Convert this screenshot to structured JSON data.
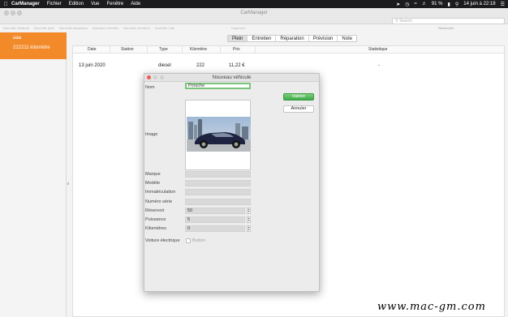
{
  "menubar": {
    "app_name": "CarManager",
    "items": [
      "Fichier",
      "Edition",
      "Vue",
      "Fenêtre",
      "Aide"
    ],
    "battery": "91 %",
    "datetime": "14 juin à 22:18"
  },
  "window": {
    "title": "CarManager",
    "search_placeholder": "Search",
    "search_label": "Recherche",
    "toolbar_labels": [
      "Nouvelle Véhicule",
      "Nouvelle plein",
      "Nouvelle réparation",
      "Nouvelle entretien",
      "Nouvelle prévision",
      "Nouvelle note"
    ],
    "urgences_label": "Urgences"
  },
  "sidebar": {
    "selected_name": "aaa",
    "selected_km": "222211 kilomètre"
  },
  "tabs": [
    {
      "label": "Plein",
      "active": true
    },
    {
      "label": "Entretien",
      "active": false
    },
    {
      "label": "Réparation",
      "active": false
    },
    {
      "label": "Prévision",
      "active": false
    },
    {
      "label": "Note",
      "active": false
    }
  ],
  "table": {
    "columns": [
      "Date",
      "Station",
      "Type",
      "Kilomètre",
      "Prix",
      "Statistique"
    ],
    "rows": [
      [
        "13 juin 2020",
        "",
        "diesel",
        "222",
        "11,22 €",
        "-"
      ]
    ]
  },
  "modal": {
    "title": "Nouveau véhicule",
    "valider": "Valider",
    "annuler": "Annuler",
    "fields": {
      "nom": {
        "label": "Nom",
        "value": "Porsche"
      },
      "image": {
        "label": "Image"
      },
      "marque": {
        "label": "Marque",
        "value": ""
      },
      "modele": {
        "label": "Modèle",
        "value": ""
      },
      "immatriculation": {
        "label": "Immatriculation",
        "value": ""
      },
      "numero_serie": {
        "label": "Numéro série",
        "value": ""
      },
      "reservoir": {
        "label": "Réservoir",
        "value": "50"
      },
      "puissance": {
        "label": "Puissance",
        "value": "5"
      },
      "kilometres": {
        "label": "Kilomètres",
        "value": "0"
      },
      "voiture_electrique": {
        "label": "Voiture électrique",
        "checkbox_label": "Button",
        "checked": false
      }
    }
  },
  "watermark": "www.mac-gm.com"
}
